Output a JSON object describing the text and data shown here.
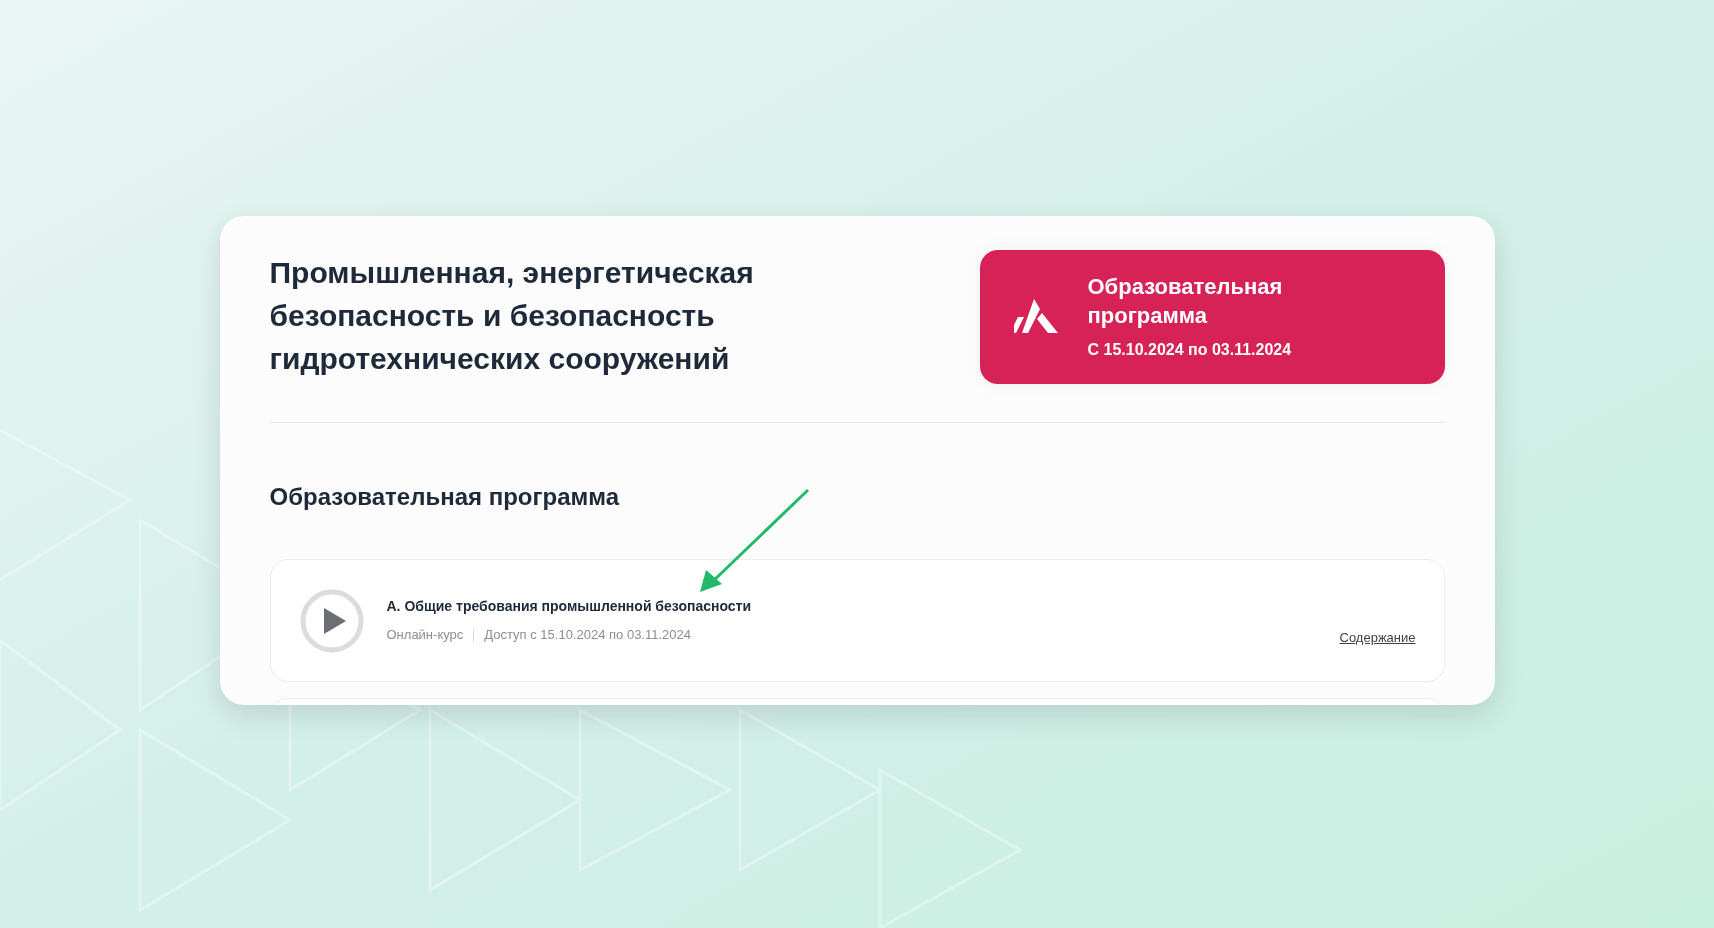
{
  "program": {
    "title": "Промышленная, энергетическая безопасность и безопасность гидротехнических сооружений"
  },
  "badge": {
    "title": "Образовательная программа",
    "dates": "С 15.10.2024 по 03.11.2024"
  },
  "section": {
    "title": "Образовательная программа"
  },
  "courses": [
    {
      "title": "А. Общие требования промышленной безопасности",
      "type": "Онлайн-курс",
      "access": "Доступ с 15.10.2024 по 03.11.2024",
      "link": "Содержание"
    }
  ]
}
